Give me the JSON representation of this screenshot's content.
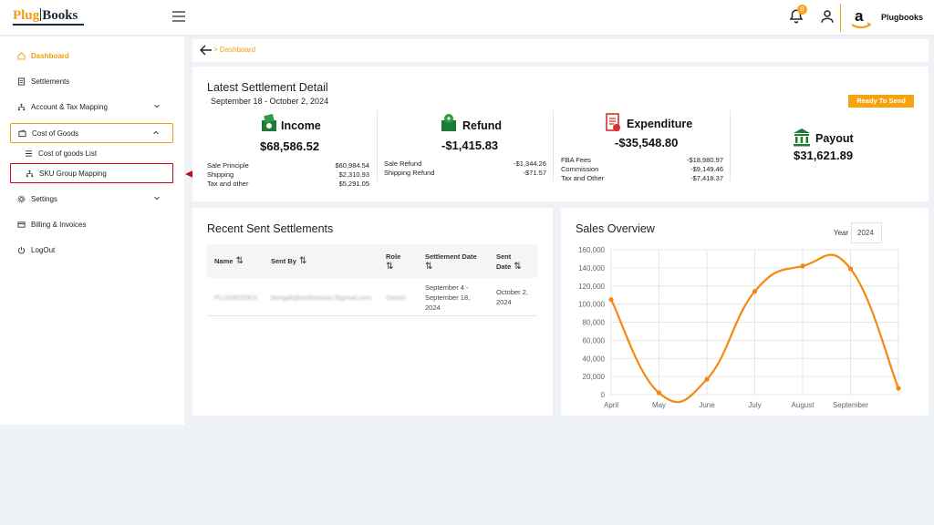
{
  "brand": {
    "logo_text_left": "Plug",
    "logo_text_right": "Books",
    "store_name": "Plugbooks",
    "notification_count": "0",
    "accent": "#f39c12"
  },
  "sidebar": {
    "items": [
      {
        "label": "Dashboard",
        "icon": "home-icon"
      },
      {
        "label": "Settlements",
        "icon": "receipt-icon"
      },
      {
        "label": "Account & Tax Mapping",
        "icon": "hierarchy-icon"
      },
      {
        "label": "Cost of Goods",
        "icon": "wallet-icon"
      },
      {
        "label": "Cost of goods List",
        "icon": "list-icon"
      },
      {
        "label": "SKU Group Mapping",
        "icon": "hierarchy-icon"
      },
      {
        "label": "Settings",
        "icon": "gear-icon"
      },
      {
        "label": "Billing & Invoices",
        "icon": "card-icon"
      },
      {
        "label": "LogOut",
        "icon": "power-icon"
      }
    ]
  },
  "breadcrumb": {
    "label": "Dashboard"
  },
  "latest": {
    "title": "Latest Settlement Detail",
    "dates": "September 18 - October 2, 2024",
    "status": "Ready To Send",
    "income": {
      "title": "Income",
      "amount": "$68,586.52",
      "rows": [
        {
          "label": "Sale Principle",
          "value": "$60,984.54"
        },
        {
          "label": "Shipping",
          "value": "$2,310.93"
        },
        {
          "label": "Tax and other",
          "value": "$5,291.05"
        }
      ]
    },
    "refund": {
      "title": "Refund",
      "amount": "-$1,415.83",
      "rows": [
        {
          "label": "Sale Refund",
          "value": "-$1,344.26"
        },
        {
          "label": "Shipping Refund",
          "value": "-$71.57"
        }
      ]
    },
    "expenditure": {
      "title": "Expenditure",
      "amount": "-$35,548.80",
      "rows": [
        {
          "label": "FBA Fees",
          "value": "-$18,980.97"
        },
        {
          "label": "Commission",
          "value": "-$9,149.46"
        },
        {
          "label": "Tax and Other",
          "value": "-$7,418.37"
        }
      ]
    },
    "payout": {
      "title": "Payout",
      "amount": "$31,621.89"
    }
  },
  "recent": {
    "title": "Recent Sent Settlements",
    "columns": [
      "Name",
      "Sent By",
      "Role",
      "Settlement Date",
      "Sent Date"
    ],
    "rows": [
      {
        "name": "PLUGBOOKS",
        "sent_by": "bengali@webmusari.fbgmail.com",
        "role": "Owner",
        "settlement_date": "September 4 - September 18, 2024",
        "sent_date": "October 2, 2024"
      }
    ]
  },
  "sales": {
    "title": "Sales Overview",
    "year_label": "Year",
    "year_value": "2024"
  },
  "chart_data": {
    "type": "line",
    "title": "",
    "categories": [
      "April",
      "May",
      "June",
      "July",
      "August",
      "September"
    ],
    "x": [
      "April",
      "May",
      "June",
      "July",
      "August",
      "September",
      ""
    ],
    "series": [
      {
        "values": [
          105000,
          2000,
          17000,
          114000,
          142000,
          139000,
          7000
        ]
      }
    ],
    "yticks": [
      "0",
      "20,000",
      "40,000",
      "60,000",
      "80,000",
      "100,000",
      "120,000",
      "140,000",
      "160,000"
    ],
    "ylim": [
      0,
      160000
    ],
    "grid": true,
    "color": "#f5890f"
  }
}
